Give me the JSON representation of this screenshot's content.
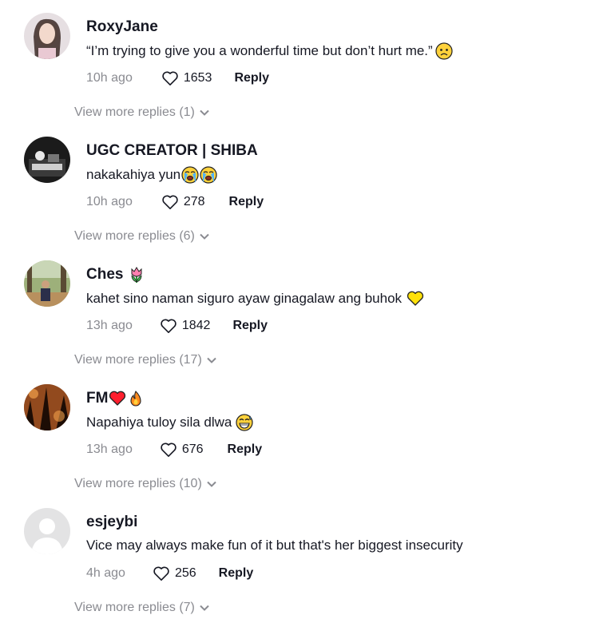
{
  "comments": [
    {
      "username": "RoxyJane",
      "name_emojis": [],
      "text": "“I’m trying to give you a wonderful time but don’t hurt me.”",
      "text_emojis": [
        "worried-face"
      ],
      "time": "10h ago",
      "likes": "1653",
      "reply_label": "Reply",
      "view_more": "View more replies (1)"
    },
    {
      "username": "UGC CREATOR | SHIBA",
      "name_emojis": [],
      "text": "nakakahiya yun",
      "text_emojis": [
        "loudly-crying-face",
        "loudly-crying-face"
      ],
      "time": "10h ago",
      "likes": "278",
      "reply_label": "Reply",
      "view_more": "View more replies (6)"
    },
    {
      "username": "Ches",
      "name_emojis": [
        "tulip"
      ],
      "text": "kahet sino naman siguro ayaw ginagalaw ang buhok",
      "text_emojis": [
        "yellow-heart"
      ],
      "time": "13h ago",
      "likes": "1842",
      "reply_label": "Reply",
      "view_more": "View more replies (17)"
    },
    {
      "username": "FM",
      "name_emojis": [
        "red-heart",
        "fire"
      ],
      "text": "Napahiya tuloy sila dlwa",
      "text_emojis": [
        "grinning-sweat-face"
      ],
      "time": "13h ago",
      "likes": "676",
      "reply_label": "Reply",
      "view_more": "View more replies (10)"
    },
    {
      "username": "esjeybi",
      "name_emojis": [],
      "text": "Vice may always make fun of it but that's her biggest insecurity",
      "text_emojis": [],
      "time": "4h ago",
      "likes": "256",
      "reply_label": "Reply",
      "view_more": "View more replies (7)"
    }
  ],
  "colors": {
    "text_primary": "#161823",
    "text_secondary": "#8a8b91",
    "background": "#ffffff"
  }
}
